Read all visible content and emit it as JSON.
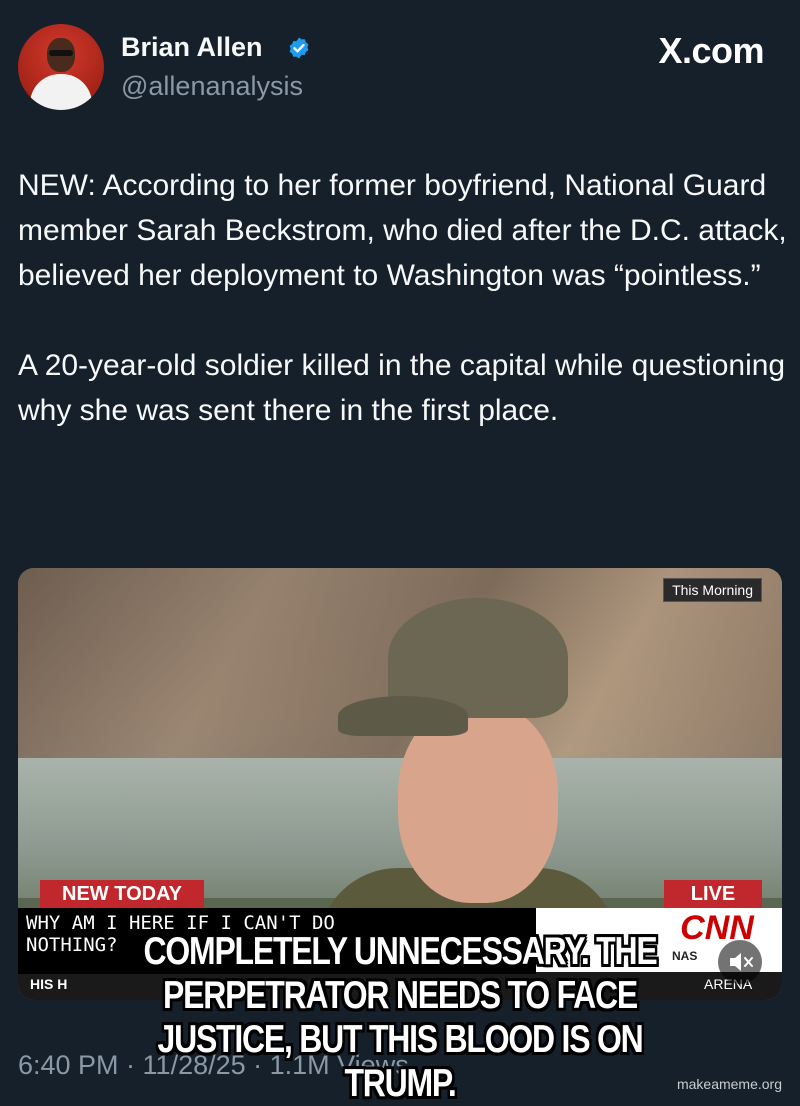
{
  "author": {
    "name": "Brian Allen",
    "handle": "@allenanalysis",
    "verified": true,
    "verified_color": "#1d9bf0"
  },
  "brand": "X.com",
  "tweet": {
    "paragraphs": [
      "NEW: According to her former boyfriend, National Guard member Sarah Beckstrom, who died after the D.C. attack, believed her deployment to Washington was “pointless.”",
      "A 20-year-old soldier killed in the capital while questioning why she was sent there in the first place."
    ]
  },
  "media": {
    "network_tag": "This Morning",
    "badge_left": "NEW TODAY",
    "badge_right": "LIVE",
    "subtitle": "WHY AM I HERE IF I CAN'T DO\nNOTHING?",
    "logo": "CNN",
    "ticker_left": "HIS H",
    "ticker_nas": "NAS",
    "ticker_right": "ARENA",
    "mute_icon": "speaker-muted-icon"
  },
  "meta_line": "6:40 PM · 11/28/25 · 1.1M Views",
  "meme_caption": "COMPLETELY UNNECESSARY. THE PERPETRATOR NEEDS TO FACE JUSTICE, BUT THIS BLOOD IS ON TRUMP.",
  "watermark": "makeameme.org",
  "colors": {
    "background": "#15202b",
    "text": "#f7f9f9",
    "secondary": "#8b98a5",
    "cnn_red": "#c0282d"
  }
}
